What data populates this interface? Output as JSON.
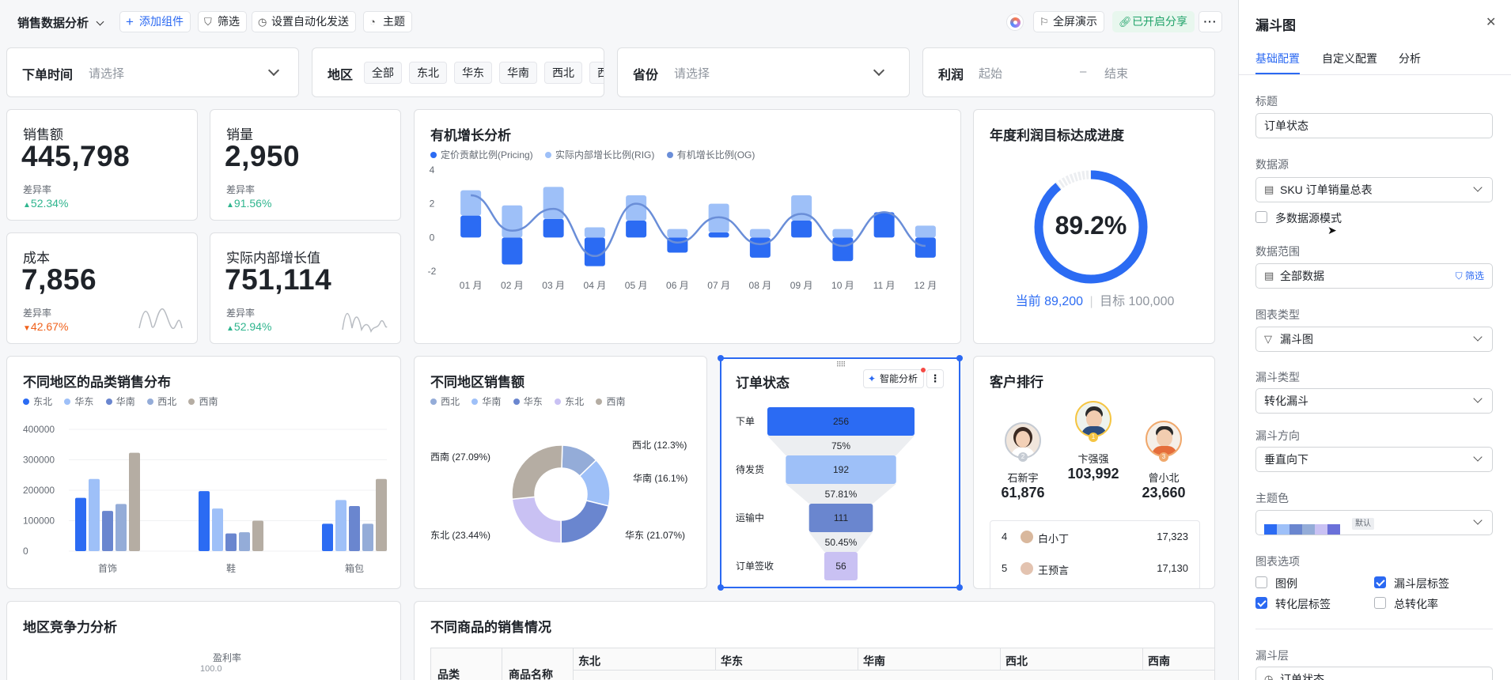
{
  "topbar": {
    "title": "销售数据分析",
    "add_component": "添加组件",
    "filter": "筛选",
    "auto_send": "设置自动化发送",
    "theme": "主题",
    "fullscreen": "全屏演示",
    "share": "已开启分享"
  },
  "filters": {
    "order_time": {
      "label": "下单时间",
      "placeholder": "请选择"
    },
    "region": {
      "label": "地区",
      "chips": [
        "全部",
        "东北",
        "华东",
        "华南",
        "西北",
        "西"
      ]
    },
    "province": {
      "label": "省份",
      "placeholder": "请选择"
    },
    "profit": {
      "label": "利润",
      "start": "起始",
      "dash": "–",
      "end": "结束"
    }
  },
  "kpis": [
    {
      "title": "销售额",
      "value": "445,798",
      "sub": "差异率",
      "change": "52.34%",
      "dir": "up"
    },
    {
      "title": "销量",
      "value": "2,950",
      "sub": "差异率",
      "change": "91.56%",
      "dir": "up"
    },
    {
      "title": "成本",
      "value": "7,856",
      "sub": "差异率",
      "change": "42.67%",
      "dir": "down"
    },
    {
      "title": "实际内部增长值",
      "value": "751,114",
      "sub": "差异率",
      "change": "52.94%",
      "dir": "up"
    }
  ],
  "organic": {
    "title": "有机增长分析",
    "legend": [
      "定价贡献比例(Pricing)",
      "实际内部增长比例(RIG)",
      "有机增长比例(OG)"
    ],
    "colors": [
      "#2b6bf3",
      "#9ec0f8",
      "#6a8ed8"
    ]
  },
  "target": {
    "title": "年度利润目标达成进度",
    "percent": "89.2%",
    "progress": 0.892,
    "current": "当前 89,200",
    "target": "目标 100,000"
  },
  "region_cat": {
    "title": "不同地区的品类销售分布",
    "legend": [
      "东北",
      "华东",
      "华南",
      "西北",
      "西南"
    ],
    "colors": [
      "#2b6bf3",
      "#9ec0f8",
      "#6a86cf",
      "#94acd8",
      "#b5ada3"
    ]
  },
  "region_sales": {
    "title": "不同地区销售额",
    "legend": [
      "西北",
      "华南",
      "华东",
      "东北",
      "西南"
    ]
  },
  "order_status": {
    "title": "订单状态",
    "ai_button": "智能分析",
    "more": "⋮"
  },
  "customers": {
    "title": "客户排行",
    "top": [
      {
        "rank": "2",
        "name": "石新宇",
        "value": "61,876"
      },
      {
        "rank": "1",
        "name": "卞强强",
        "value": "103,992"
      },
      {
        "rank": "3",
        "name": "曾小北",
        "value": "23,660"
      }
    ],
    "list": [
      {
        "rank": "4",
        "name": "白小丁",
        "value": "17,323"
      },
      {
        "rank": "5",
        "name": "王预言",
        "value": "17,130"
      }
    ]
  },
  "competition": {
    "title": "地区竞争力分析",
    "axis_label": "盈利率",
    "axis_value": "100.0"
  },
  "products": {
    "title": "不同商品的销售情况",
    "col_category": "品类",
    "col_product": "商品名称",
    "regions": [
      "东北",
      "华东",
      "华南",
      "西北",
      "西南"
    ]
  },
  "panel": {
    "title": "漏斗图",
    "close": "✕",
    "tabs": [
      "基础配置",
      "自定义配置",
      "分析"
    ],
    "title_label": "标题",
    "title_value": "订单状态",
    "datasource_label": "数据源",
    "datasource_value": "SKU 订单销量总表",
    "multi_source": "多数据源模式",
    "range_label": "数据范围",
    "range_value": "全部数据",
    "range_filter": "筛选",
    "chart_type_label": "图表类型",
    "chart_type_value": "漏斗图",
    "funnel_type_label": "漏斗类型",
    "funnel_type_value": "转化漏斗",
    "direction_label": "漏斗方向",
    "direction_value": "垂直向下",
    "color_label": "主题色",
    "color_default": "默认",
    "palette": [
      "#2b6bf3",
      "#9ec0f8",
      "#6a86cf",
      "#94acd8",
      "#c9c1f3",
      "#6a70d9"
    ],
    "options_label": "图表选项",
    "options": [
      {
        "label": "图例",
        "checked": false
      },
      {
        "label": "漏斗层标签",
        "checked": true
      },
      {
        "label": "转化层标签",
        "checked": true
      },
      {
        "label": "总转化率",
        "checked": false
      }
    ],
    "layer_label": "漏斗层",
    "layer_value": "订单状态"
  },
  "chart_data": [
    {
      "type": "bar",
      "title": "有机增长分析",
      "categories": [
        "01 月",
        "02 月",
        "03 月",
        "04 月",
        "05 月",
        "06 月",
        "07 月",
        "08 月",
        "09 月",
        "10 月",
        "11 月",
        "12 月"
      ],
      "ylim": [
        -2,
        4
      ],
      "yticks": [
        4,
        2,
        0,
        -2
      ],
      "stacked": true,
      "series": [
        {
          "name": "定价贡献比例(Pricing)",
          "values": [
            1.3,
            -1.6,
            1.1,
            -1.7,
            1.0,
            -0.9,
            0.3,
            -1.2,
            1.0,
            -1.4,
            1.5,
            -1.2
          ]
        },
        {
          "name": "实际内部增长比例(RIG)",
          "values": [
            1.5,
            1.9,
            1.9,
            0.6,
            1.5,
            0.5,
            1.7,
            0.5,
            1.5,
            0.5,
            0.0,
            0.7
          ]
        },
        {
          "name": "有机增长比例(OG)",
          "values": [
            2.5,
            0.4,
            1.7,
            -1.1,
            2.0,
            -0.3,
            1.2,
            -0.4,
            1.4,
            -0.5,
            1.5,
            -0.5
          ]
        }
      ]
    },
    {
      "type": "bar",
      "title": "不同地区的品类销售分布",
      "categories": [
        "首饰",
        "鞋",
        "箱包"
      ],
      "ylim": [
        0,
        400000
      ],
      "yticks": [
        400000,
        300000,
        200000,
        100000,
        0
      ],
      "series": [
        {
          "name": "东北",
          "values": [
            175000,
            197000,
            90000
          ]
        },
        {
          "name": "华东",
          "values": [
            237000,
            140000,
            168000
          ]
        },
        {
          "name": "华南",
          "values": [
            132000,
            58000,
            148000
          ]
        },
        {
          "name": "西北",
          "values": [
            155000,
            62000,
            90000
          ]
        },
        {
          "name": "西南",
          "values": [
            323000,
            100000,
            237000
          ]
        }
      ]
    },
    {
      "type": "pie",
      "title": "不同地区销售额",
      "categories": [
        "西北",
        "华南",
        "华东",
        "东北",
        "西南"
      ],
      "values": [
        12.3,
        16.1,
        21.07,
        23.44,
        27.09
      ],
      "labels": [
        "西北 (12.3%)",
        "华南 (16.1%)",
        "华东 (21.07%)",
        "东北 (23.44%)",
        "西南 (27.09%)"
      ]
    },
    {
      "type": "funnel",
      "title": "订单状态",
      "categories": [
        "下单",
        "待发货",
        "运输中",
        "订单签收"
      ],
      "values": [
        256,
        192,
        111,
        56
      ],
      "conversions": [
        "75%",
        "57.81%",
        "50.45%"
      ]
    }
  ]
}
